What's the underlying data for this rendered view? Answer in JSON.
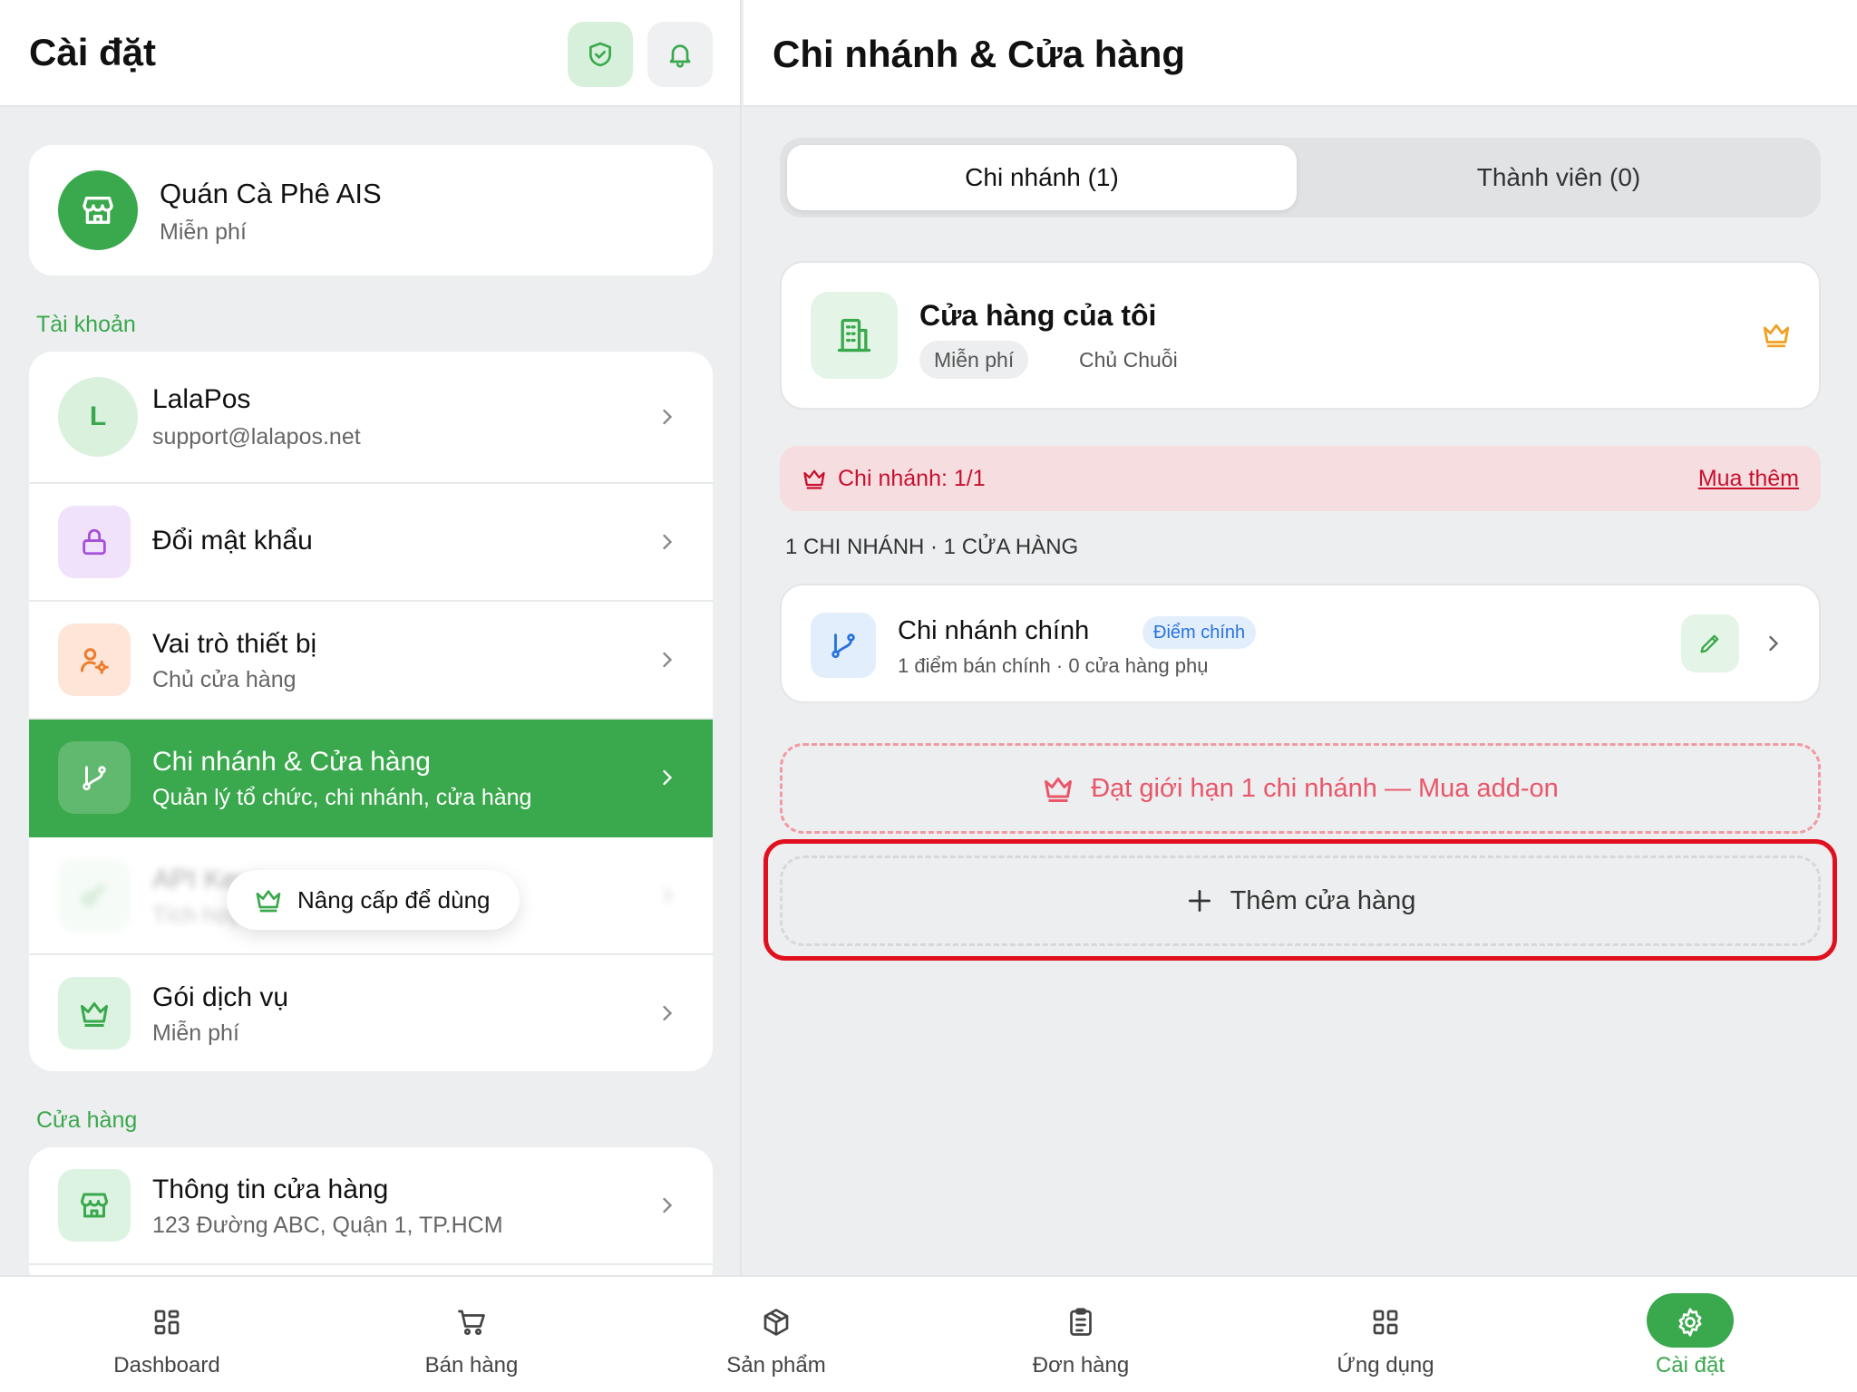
{
  "left": {
    "title": "Cài đặt",
    "store": {
      "name": "Quán Cà Phê AIS",
      "plan": "Miễn phí"
    },
    "account_section_label": "Tài khoản",
    "account": {
      "avatar_letter": "L",
      "name": "LalaPos",
      "email": "support@lalapos.net"
    },
    "menu": {
      "change_password": "Đổi mật khẩu",
      "device_role": {
        "label": "Vai trò thiết bị",
        "sub": "Chủ cửa hàng"
      },
      "branches": {
        "label": "Chi nhánh & Cửa hàng",
        "sub": "Quản lý tổ chức, chi nhánh, cửa hàng"
      },
      "api_keys": {
        "label": "API Keys",
        "sub": "Tích hợp"
      },
      "upgrade_label": "Nâng cấp để dùng",
      "service_plan": {
        "label": "Gói dịch vụ",
        "sub": "Miễn phí"
      }
    },
    "shop_section_label": "Cửa hàng",
    "shop_info": {
      "label": "Thông tin cửa hàng",
      "sub": "123 Đường ABC, Quận 1, TP.HCM"
    }
  },
  "right": {
    "title": "Chi nhánh & Cửa hàng",
    "tabs": [
      {
        "label": "Chi nhánh (1)",
        "active": true
      },
      {
        "label": "Thành viên (0)",
        "active": false
      }
    ],
    "my_store": {
      "name": "Cửa hàng của tôi",
      "plan": "Miễn phí",
      "role": "Chủ Chuỗi"
    },
    "limit": {
      "text": "Chi nhánh: 1/1",
      "buy_link": "Mua thêm"
    },
    "summary": "1 CHI NHÁNH · 1 CỬA HÀNG",
    "branch": {
      "name": "Chi nhánh chính",
      "badge": "Điểm chính",
      "sub": "1 điểm bán chính · 0 cửa hàng phụ"
    },
    "limit_reached": "Đạt giới hạn 1 chi nhánh — Mua add-on",
    "add_store": "Thêm cửa hàng"
  },
  "nav": [
    {
      "label": "Dashboard",
      "icon": "grid-icon",
      "active": false
    },
    {
      "label": "Bán hàng",
      "icon": "cart-icon",
      "active": false
    },
    {
      "label": "Sản phẩm",
      "icon": "box-icon",
      "active": false
    },
    {
      "label": "Đơn hàng",
      "icon": "clipboard-icon",
      "active": false
    },
    {
      "label": "Ứng dụng",
      "icon": "apps-icon",
      "active": false
    },
    {
      "label": "Cài đặt",
      "icon": "gear-icon",
      "active": true
    }
  ],
  "colors": {
    "accent": "#3aa84c",
    "danger": "#c8102e",
    "badge_blue": "#2673dd",
    "crown_orange": "#f0a020"
  }
}
